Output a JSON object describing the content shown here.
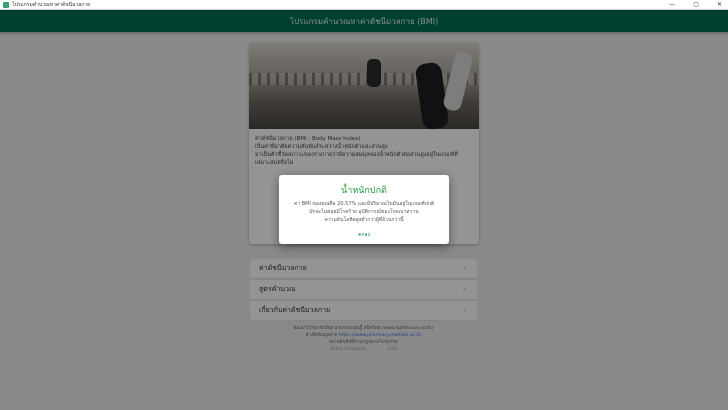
{
  "window": {
    "title": "โปรแกรมคำนวณหาค่าดัชนีมวลกาย",
    "minimize": "—",
    "maximize": "▢",
    "close": "✕"
  },
  "appbar": {
    "title": "โปรแกรมคำนวณหาค่าดัชนีมวลกาย (BMI)"
  },
  "card": {
    "line1": "ค่าดัชนีมวลกาย (BMI : Body Mass Index)",
    "line2": "เป็นค่าที่อาศัยความสัมพันธ์ระหว่างน้ำหนักตัวและส่วนสูง",
    "line3": "มาเป็นตัวชี้วัดสภาวะของร่างกายว่ามีความสมดุลของน้ำหนักตัวต่อส่วนสูงอยู่ในเกณฑ์ที่เหมาะสมหรือไม่"
  },
  "expanders": [
    {
      "label": "ค่าดัชนีมวลกาย"
    },
    {
      "label": "สูตรคำนวณ"
    },
    {
      "label": "เกี่ยวกับค่าดัชนีมวลกาย"
    }
  ],
  "footer": {
    "line1": "พัฒนาโปรแกรมโดย นายกอบกฤษฎิ์ สนิทไทย (www.lighthouse.co.th)",
    "line2_prefix": "อ้างอิงข้อมูลจาก",
    "line2_link": "https://www.pharmacy.mahidol.ac.th",
    "line3": "สงวนลิขสิทธิ์ตามกฎหมายโปรแกรม",
    "btn1": "Share Facebook",
    "btn2": "Line"
  },
  "dialog": {
    "title": "น้ำหนักปกติ",
    "msg1": "ค่า BMI ของคุณคือ 20.57% และมีปริมาณไขมันอยู่ในเกณฑ์ปกติ",
    "msg2": "มักจะไม่ค่อยมีโรคร้าย อุบัติการณ์ของโรคเบาหวาน",
    "msg3": "ความดันโลหิตสูงต่ำกว่าผู้ที่อ้วนกว่านี้",
    "ok": "ตกลง"
  },
  "colors": {
    "appbar": "#006e52",
    "dialog_title": "#1a9c3a",
    "ok": "#0a7a5a"
  }
}
